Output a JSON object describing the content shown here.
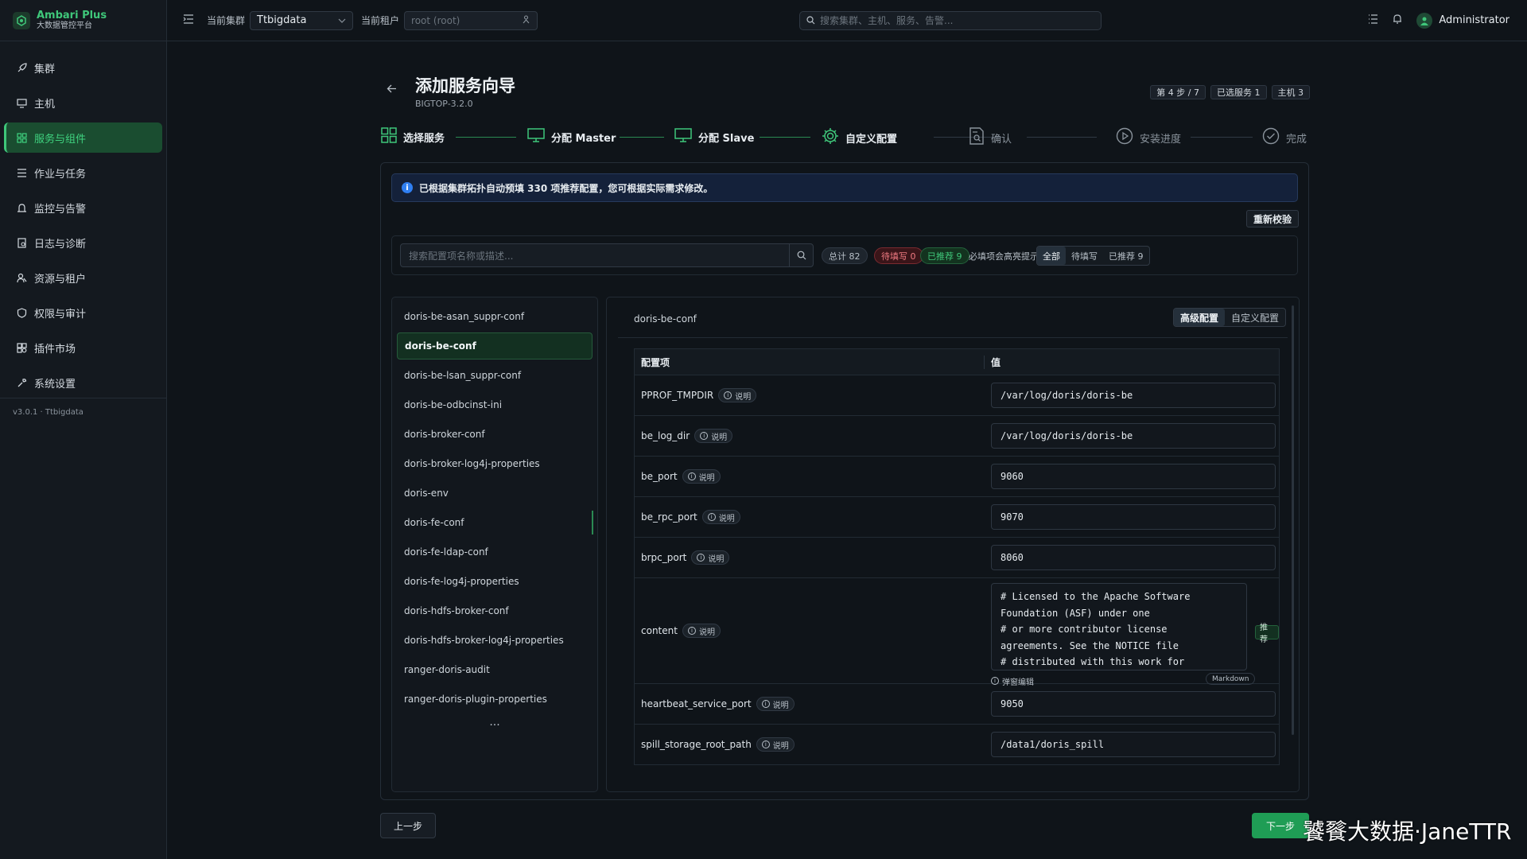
{
  "brand": {
    "name": "Ambari Plus",
    "subtitle": "大数据管控平台"
  },
  "sidebar": {
    "items": [
      {
        "label": "集群",
        "icon": "rocket-icon"
      },
      {
        "label": "主机",
        "icon": "monitor-icon"
      },
      {
        "label": "服务与组件",
        "icon": "grid-icon",
        "active": true
      },
      {
        "label": "作业与任务",
        "icon": "list-icon"
      },
      {
        "label": "监控与告警",
        "icon": "alarm-icon"
      },
      {
        "label": "日志与诊断",
        "icon": "log-icon"
      },
      {
        "label": "资源与租户",
        "icon": "users-icon"
      },
      {
        "label": "权限与审计",
        "icon": "shield-icon"
      },
      {
        "label": "插件市场",
        "icon": "puzzle-icon"
      },
      {
        "label": "系统设置",
        "icon": "wrench-icon"
      }
    ],
    "footer": "v3.0.1 · Ttbigdata"
  },
  "topbar": {
    "cluster_label": "当前集群",
    "cluster_value": "Ttbigdata",
    "tenant_label": "当前租户",
    "tenant_placeholder": "root (root)",
    "search_placeholder": "搜索集群、主机、服务、告警...",
    "user": "Administrator"
  },
  "wizard": {
    "title": "添加服务向导",
    "stack": "BIGTOP-3.2.0",
    "badges": [
      "第 4 步 / 7",
      "已选服务 1",
      "主机 3"
    ],
    "steps": [
      {
        "label": "选择服务",
        "state": "done"
      },
      {
        "label": "分配 Master",
        "state": "done"
      },
      {
        "label": "分配 Slave",
        "state": "done"
      },
      {
        "label": "自定义配置",
        "state": "current"
      },
      {
        "label": "确认",
        "state": "pending"
      },
      {
        "label": "安装进度",
        "state": "pending"
      },
      {
        "label": "完成",
        "state": "pending"
      }
    ],
    "info": "已根据集群拓扑自动预填 330 项推荐配置，您可根据实际需求修改。",
    "revalidate": "重新校验",
    "prev": "上一步",
    "next": "下一步"
  },
  "filter": {
    "search_placeholder": "搜索配置项名称或描述...",
    "total": "总计 82",
    "pending": "待填写 0",
    "recommended": "已推荐 9",
    "hint": "必填项会高亮提示",
    "segments": [
      "全部",
      "待填写",
      "已推荐 9"
    ],
    "active_segment": "全部"
  },
  "config_list": {
    "items": [
      "doris-be-asan_suppr-conf",
      "doris-be-conf",
      "doris-be-lsan_suppr-conf",
      "doris-be-odbcinst-ini",
      "doris-broker-conf",
      "doris-broker-log4j-properties",
      "doris-env",
      "doris-fe-conf",
      "doris-fe-ldap-conf",
      "doris-fe-log4j-properties",
      "doris-hdfs-broker-conf",
      "doris-hdfs-broker-log4j-properties",
      "ranger-doris-audit",
      "ranger-doris-plugin-properties"
    ],
    "active": "doris-be-conf",
    "more": "..."
  },
  "detail": {
    "title": "doris-be-conf",
    "tabs": [
      "高级配置",
      "自定义配置"
    ],
    "active_tab": "高级配置",
    "col_key": "配置项",
    "col_value": "值",
    "explain_label": "说明",
    "rows": [
      {
        "key": "PPROF_TMPDIR",
        "value": "/var/log/doris/doris-be"
      },
      {
        "key": "be_log_dir",
        "value": "/var/log/doris/doris-be"
      },
      {
        "key": "be_port",
        "value": "9060"
      },
      {
        "key": "be_rpc_port",
        "value": "9070"
      },
      {
        "key": "brpc_port",
        "value": "8060"
      },
      {
        "key": "content",
        "value": "# Licensed to the Apache Software\nFoundation (ASF) under one\n# or more contributor license\nagreements.  See the NOTICE file\n# distributed with this work for",
        "recommend_tag": "推荐",
        "popup_edit": "弹窗编辑",
        "format": "Markdown"
      },
      {
        "key": "heartbeat_service_port",
        "value": "9050"
      },
      {
        "key": "spill_storage_root_path",
        "value": "/data1/doris_spill"
      }
    ]
  },
  "watermark": "饕餮大数据·JaneTTR",
  "colors": {
    "accent": "#3fc77a",
    "primary_button": "#1f9d55",
    "info": "#2f7ff2",
    "danger": "#f07a82"
  }
}
